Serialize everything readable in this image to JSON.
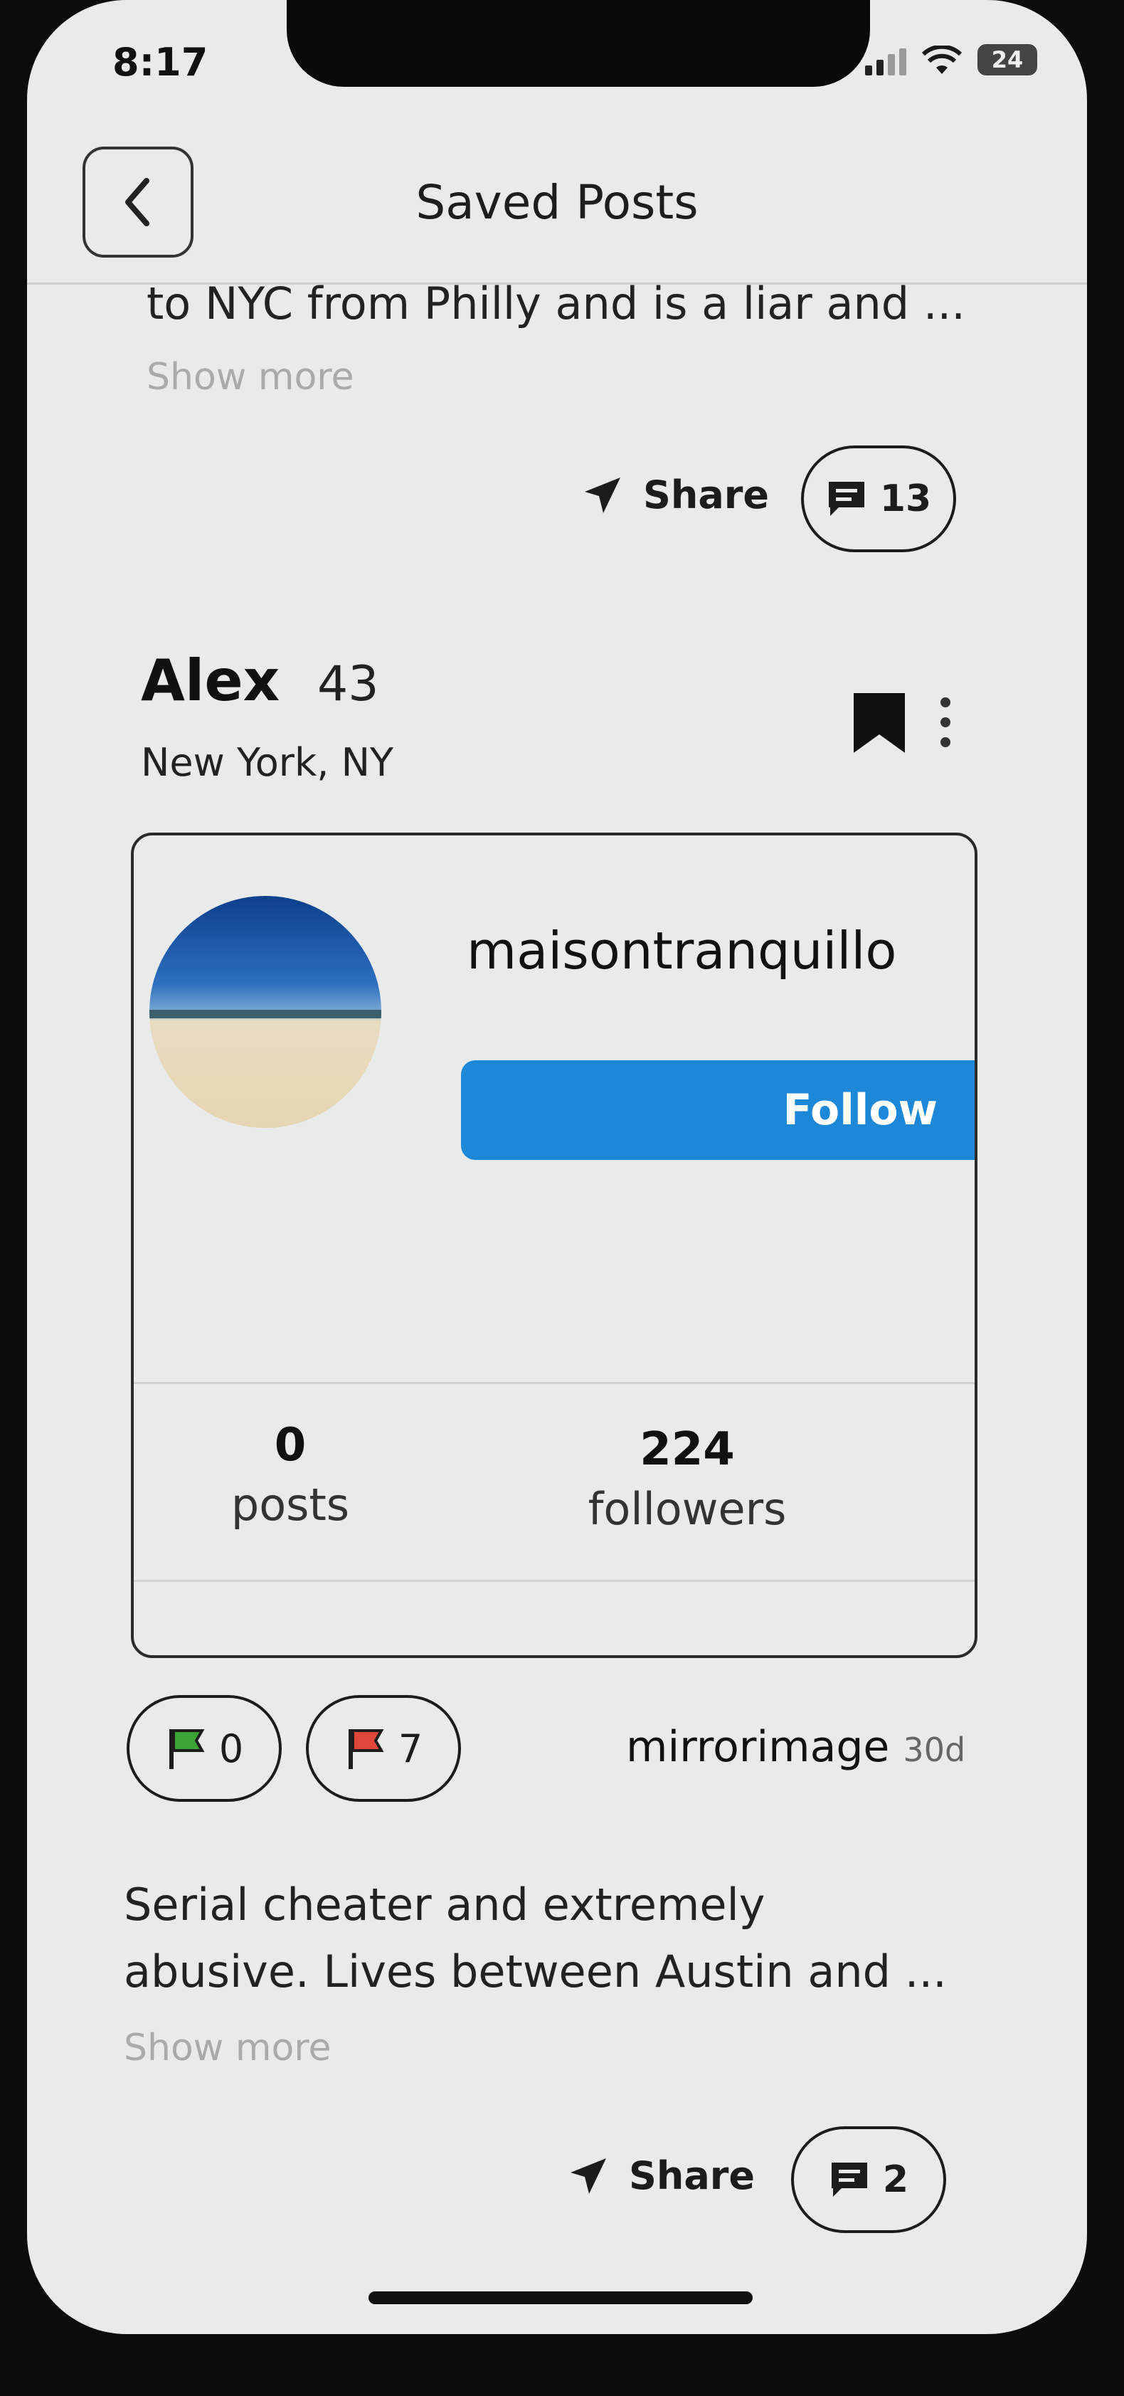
{
  "status_bar": {
    "time": "8:17",
    "battery": "24"
  },
  "header": {
    "title": "Saved Posts"
  },
  "previous_post": {
    "text_line": "to NYC from Philly and is a liar and ...",
    "show_more": "Show more",
    "share_label": "Share",
    "comment_count": "13"
  },
  "post": {
    "name": "Alex",
    "age": "43",
    "location": "New York, NY",
    "profile": {
      "handle": "maisontranquillo",
      "follow_label": "Follow",
      "stats": [
        {
          "value": "0",
          "label": "posts"
        },
        {
          "value": "224",
          "label": "followers"
        }
      ]
    },
    "green_flags": "0",
    "red_flags": "7",
    "author": "mirrorimage",
    "age_posted": "30d",
    "text_lines": [
      "Serial cheater and extremely",
      "abusive. Lives between Austin and ..."
    ],
    "show_more": "Show more",
    "share_label": "Share",
    "comment_count": "2"
  },
  "colors": {
    "follow_button": "#1e88d8",
    "green_flag": "#3aa535",
    "red_flag": "#e0463a",
    "screen_background": "#e9ebea"
  },
  "icons": [
    "back-chevron-icon",
    "send-icon",
    "comment-icon",
    "bookmark-icon",
    "more-vertical-icon",
    "green-flag-icon",
    "red-flag-icon",
    "wifi-icon",
    "signal-icon",
    "battery-icon"
  ]
}
